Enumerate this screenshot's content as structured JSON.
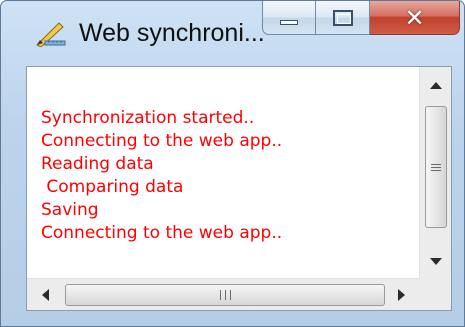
{
  "window": {
    "title": "Web synchroni...",
    "icon": "pencil-ruler-icon",
    "controls": {
      "minimize": "minimize-icon",
      "maximize": "maximize-icon",
      "close": "close-icon"
    }
  },
  "log": {
    "text_color": "#ff0000",
    "lines": [
      "Synchronization started..",
      "Connecting to the web app..",
      "Reading data",
      " Comparing data",
      "Saving",
      "Connecting to the web app.."
    ]
  },
  "scrollbars": {
    "vertical_thumb_fraction": 0.0,
    "horizontal_thumb_fraction": 0.0
  },
  "colors": {
    "close_button": "#c2402d",
    "frame": "#bcd3ec"
  }
}
